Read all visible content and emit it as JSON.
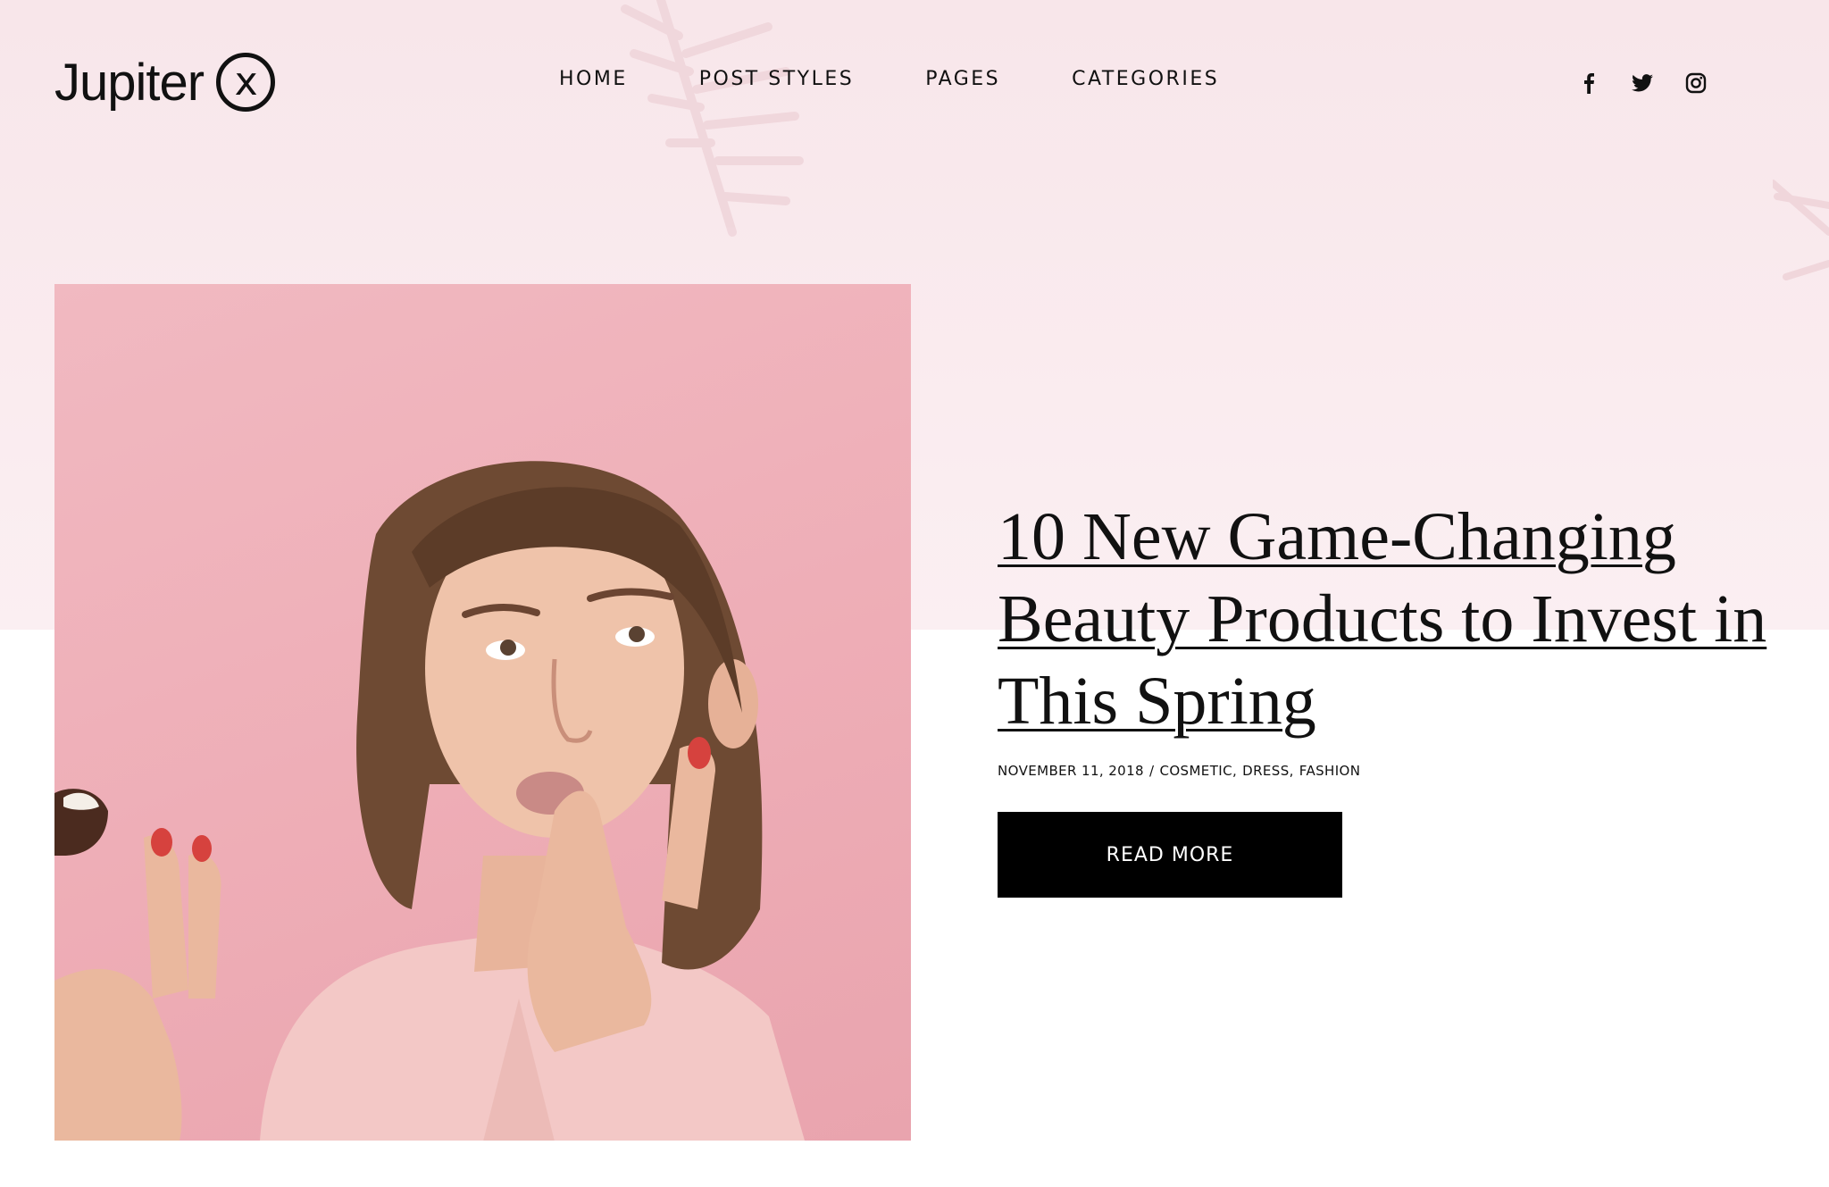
{
  "header": {
    "logo_text": "Jupiter",
    "logo_mark": "x",
    "nav": [
      {
        "label": "HOME"
      },
      {
        "label": "POST STYLES"
      },
      {
        "label": "PAGES"
      },
      {
        "label": "CATEGORIES"
      }
    ],
    "social": [
      {
        "icon": "facebook-icon"
      },
      {
        "icon": "twitter-icon"
      },
      {
        "icon": "instagram-icon"
      }
    ]
  },
  "featured_post": {
    "title": "10 New Game-Changing Beauty Products to Invest in This Spring",
    "date": "NOVEMBER 11, 2018",
    "separator": "/",
    "categories": [
      "COSMETIC,",
      "DRESS,",
      "FASHION"
    ],
    "button_label": "READ MORE",
    "image_alt": "woman-tasting-chocolate-photo"
  },
  "colors": {
    "band": "#f8e6ea",
    "photo_bg": "#eeadb6",
    "button": "#000000",
    "text": "#111111"
  }
}
